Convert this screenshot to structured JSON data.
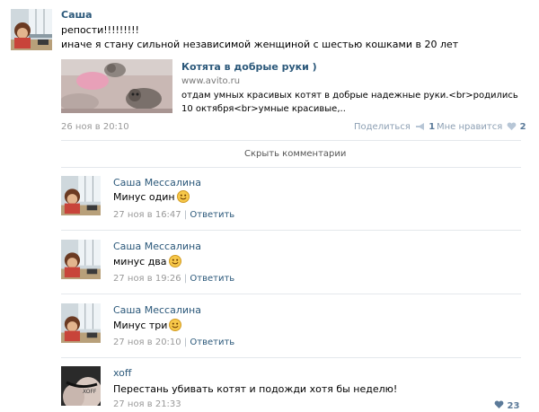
{
  "post": {
    "author": "Саша",
    "line1": "репости!!!!!!!!!",
    "line2": "иначе я стану сильной независимой женщиной с шестью кошками в 20 лет",
    "link": {
      "title": "Котята в добрые руки )",
      "domain": "www.avito.ru",
      "description": "отдам умных красивых котят в добрые надежные руки.<br>родились 10 октября<br>умные красивые,.."
    },
    "date": "26 ноя в 20:10",
    "share_label": "Поделиться",
    "share_count": "1",
    "like_label": "Мне нравится",
    "like_count": "2"
  },
  "hide_comments": "Скрыть комментарии",
  "reply_label": "Ответить",
  "comments": [
    {
      "author": "Саша Мессалина",
      "text": "Минус один",
      "date": "27 ноя в 16:47",
      "smiley": true
    },
    {
      "author": "Саша Мессалина",
      "text": "минус два",
      "date": "27 ноя в 19:26",
      "smiley": true
    },
    {
      "author": "Саша Мессалина",
      "text": "Минус три",
      "date": "27 ноя в 20:10",
      "smiley": true
    },
    {
      "author": "xoff",
      "text": "Перестань убивать котят и подожди хотя бы неделю!",
      "date": "27 ноя в 21:33",
      "smiley": false,
      "like_count": "23"
    }
  ],
  "colors": {
    "link_blue": "#2b587a",
    "meta_gray": "#999999",
    "action_gray": "#8c9fb3",
    "like_heart": "#5b7a99",
    "divider": "#e4e8ec"
  }
}
